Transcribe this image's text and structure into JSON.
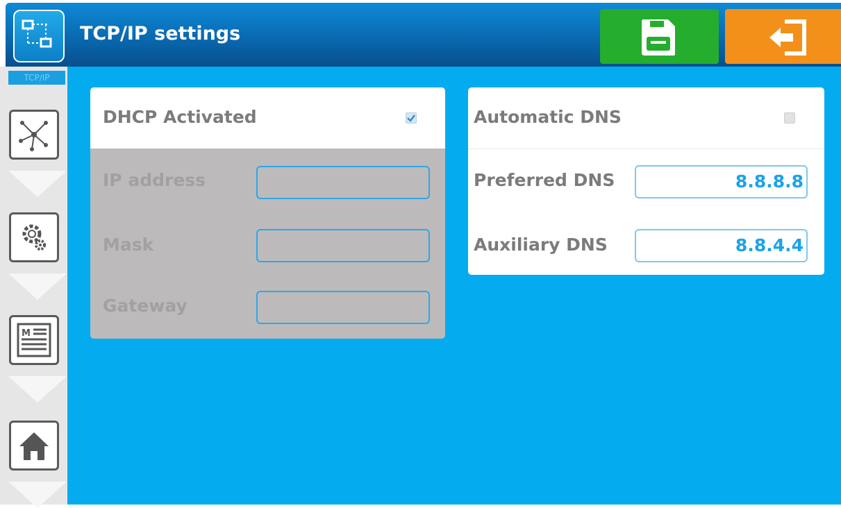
{
  "header": {
    "title": "TCP/IP settings",
    "app_icon": "network-settings-icon",
    "save_icon": "floppy-disk-icon",
    "exit_icon": "exit-arrow-icon"
  },
  "sidebar": {
    "items": [
      {
        "icon": "network-topology-icon"
      },
      {
        "icon": "gear-icon"
      },
      {
        "icon": "menu-list-icon"
      },
      {
        "icon": "home-icon"
      }
    ]
  },
  "dhcp": {
    "label": "DHCP Activated",
    "checked": true,
    "fields": [
      {
        "label": "IP address",
        "value": ""
      },
      {
        "label": "Mask",
        "value": ""
      },
      {
        "label": "Gateway",
        "value": ""
      }
    ]
  },
  "dns": {
    "label": "Automatic DNS",
    "checked": false,
    "preferred_label": "Preferred DNS",
    "preferred_value": "8.8.8.8",
    "auxiliary_label": "Auxiliary DNS",
    "auxiliary_value": "8.8.4.4"
  },
  "colors": {
    "header_blue": "#0a6fb8",
    "background_blue": "#04acef",
    "save_green": "#25ad2d",
    "exit_orange": "#f39019",
    "value_blue": "#1aa3ea"
  }
}
